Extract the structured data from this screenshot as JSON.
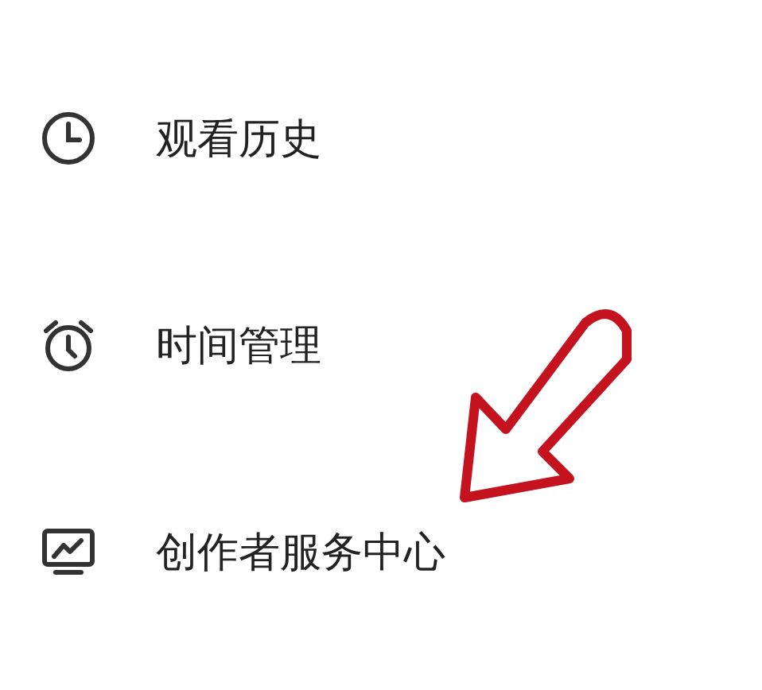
{
  "menu": {
    "items": [
      {
        "label": "观看历史"
      },
      {
        "label": "时间管理"
      },
      {
        "label": "创作者服务中心"
      }
    ]
  }
}
